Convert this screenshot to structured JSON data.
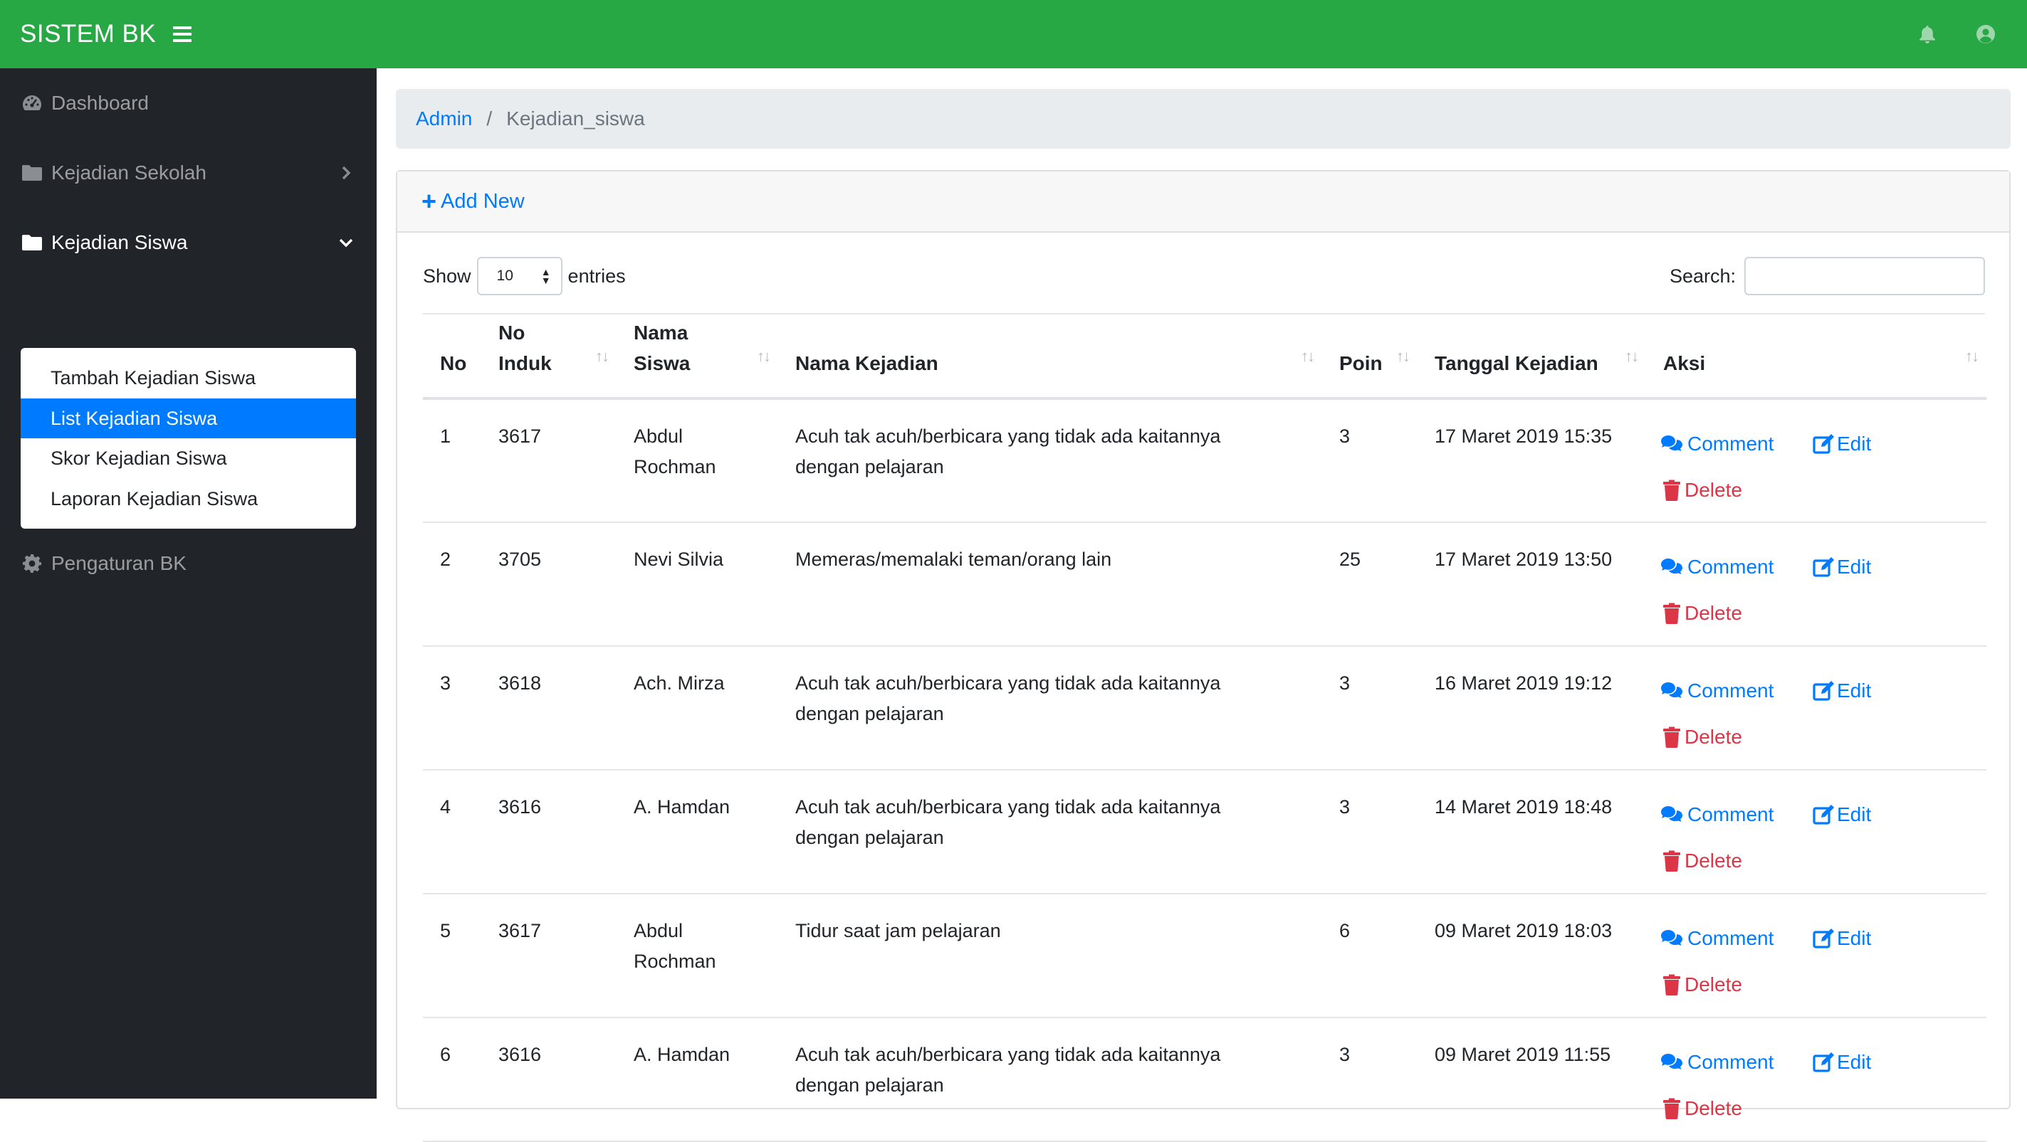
{
  "navbar": {
    "brand": "SISTEM BK",
    "menu_icon": "hamburger-icon",
    "bell_icon": "bell-icon",
    "user_icon": "user-circle-icon",
    "color": "#28a745"
  },
  "sidebar": {
    "items": [
      {
        "label": "Dashboard",
        "icon": "tachometer-icon"
      },
      {
        "label": "Kejadian Sekolah",
        "icon": "folder-icon",
        "chevron": "chevron-right-icon"
      },
      {
        "label": "Kejadian Siswa",
        "icon": "folder-icon",
        "chevron": "chevron-down-icon",
        "expanded": true
      },
      {
        "label": "Pengaturan BK",
        "icon": "gear-icon"
      }
    ],
    "submenu": [
      {
        "label": "Tambah Kejadian Siswa"
      },
      {
        "label": "List Kejadian Siswa",
        "active": true
      },
      {
        "label": "Skor Kejadian Siswa"
      },
      {
        "label": "Laporan Kejadian Siswa"
      }
    ]
  },
  "breadcrumb": {
    "root": "Admin",
    "separator": "/",
    "current": "Kejadian_siswa"
  },
  "card": {
    "add_new_label": "Add New",
    "show_label": "Show",
    "entries_value": "10",
    "entries_label": "entries",
    "search_label": "Search:",
    "search_value": ""
  },
  "table": {
    "headers": {
      "no": "No",
      "no_induk_1": "No",
      "no_induk_2": "Induk",
      "nama_siswa_1": "Nama",
      "nama_siswa_2": "Siswa",
      "nama_kejadian": "Nama Kejadian",
      "poin": "Poin",
      "tanggal": "Tanggal Kejadian",
      "aksi": "Aksi"
    },
    "actions": {
      "comment": "Comment",
      "edit": "Edit",
      "delete": "Delete"
    },
    "rows": [
      {
        "no": "1",
        "induk": "3617",
        "nama_1": "Abdul",
        "nama_2": "Rochman",
        "kejadian_1": "Acuh tak acuh/berbicara yang tidak ada kaitannya",
        "kejadian_2": "dengan pelajaran",
        "poin": "3",
        "tanggal": "17 Maret 2019 15:35"
      },
      {
        "no": "2",
        "induk": "3705",
        "nama_1": "Nevi Silvia",
        "nama_2": "",
        "kejadian_1": "Memeras/memalaki teman/orang lain",
        "kejadian_2": "",
        "poin": "25",
        "tanggal": "17 Maret 2019 13:50"
      },
      {
        "no": "3",
        "induk": "3618",
        "nama_1": "Ach. Mirza",
        "nama_2": "",
        "kejadian_1": "Acuh tak acuh/berbicara yang tidak ada kaitannya",
        "kejadian_2": "dengan pelajaran",
        "poin": "3",
        "tanggal": "16 Maret 2019 19:12"
      },
      {
        "no": "4",
        "induk": "3616",
        "nama_1": "A. Hamdan",
        "nama_2": "",
        "kejadian_1": "Acuh tak acuh/berbicara yang tidak ada kaitannya",
        "kejadian_2": "dengan pelajaran",
        "poin": "3",
        "tanggal": "14 Maret 2019 18:48"
      },
      {
        "no": "5",
        "induk": "3617",
        "nama_1": "Abdul",
        "nama_2": "Rochman",
        "kejadian_1": "Tidur saat jam pelajaran",
        "kejadian_2": "",
        "poin": "6",
        "tanggal": "09 Maret 2019 18:03"
      },
      {
        "no": "6",
        "induk": "3616",
        "nama_1": "A. Hamdan",
        "nama_2": "",
        "kejadian_1": "Acuh tak acuh/berbicara yang tidak ada kaitannya",
        "kejadian_2": "dengan pelajaran",
        "poin": "3",
        "tanggal": "09 Maret 2019 11:55"
      }
    ]
  },
  "colors": {
    "primary": "#007bff",
    "danger": "#dc3545",
    "sidebar": "#212529"
  }
}
